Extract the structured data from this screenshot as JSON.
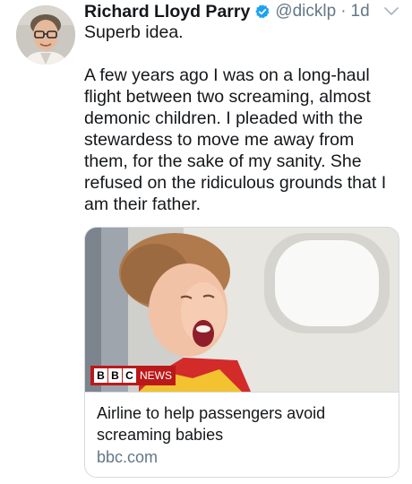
{
  "tweet": {
    "author_name": "Richard Lloyd Parry",
    "handle": "@dicklp",
    "separator": "·",
    "time": "1d",
    "verified": true,
    "paragraphs": [
      "Superb idea.",
      "A few years ago I was on a long-haul flight between two screaming, almost demonic children. I pleaded with the stewardess to move me away from them, for the sake of my sanity. She refused on the ridiculous grounds that I am their father."
    ]
  },
  "link_card": {
    "logo_letters": [
      "B",
      "B",
      "C"
    ],
    "logo_word": "NEWS",
    "title": "Airline to help passengers avoid screaming babies",
    "domain": "bbc.com"
  },
  "colors": {
    "verified_blue": "#1da1f2",
    "secondary_text": "#657786",
    "bbc_red": "#bb1919"
  },
  "icons": {
    "verified": "verified-badge-icon",
    "menu": "chevron-down-icon"
  }
}
